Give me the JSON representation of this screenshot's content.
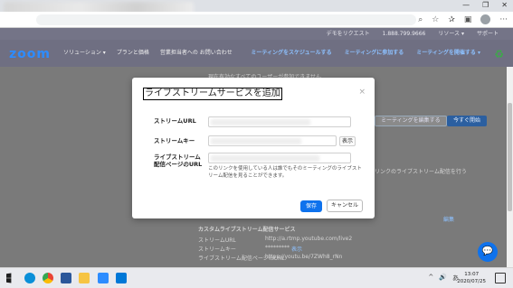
{
  "browser": {
    "window_controls": [
      "—",
      "❐",
      "✕"
    ],
    "toolbar_icons": [
      "search-icon",
      "star-icon",
      "collection-icon",
      "tab-icon",
      "profile-icon",
      "more-icon"
    ]
  },
  "zoom_top": {
    "links": [
      "デモをリクエスト",
      "1.888.799.9666",
      "リソース ▾",
      "サポート"
    ]
  },
  "nav": {
    "logo": "zoom",
    "left": [
      "ソリューション ▾",
      "プランと価格",
      "営業担当者への お問い合わせ"
    ],
    "right": [
      "ミーティングをスケジュールする",
      "ミーティングに参加する",
      "ミーティングを開催する ▾"
    ]
  },
  "background": {
    "top_text": "現在有効なすべてのユーザーが参加できません",
    "edit_button": "ミーティングを編集する",
    "start_button": "今すぐ開始",
    "right_text": "リンクのライブストリーム配信を行う",
    "edit_link": "編集",
    "custom_header": "カスタムライブストリーム配信サービス",
    "stream_url_label": "ストリームURL",
    "stream_url_value": "http://a.rtmp.youtube.com/live2",
    "stream_key_label": "ストリームキー",
    "stream_key_value": "*********",
    "show_link": "表示",
    "page_url_label": "ライブストリーム配信ページのURL",
    "page_url_value": "https://youtu.be/7ZWh8_rNn"
  },
  "dialog": {
    "title": "ライブストリームサービスを追加",
    "close": "×",
    "stream_url_label": "ストリームURL",
    "stream_key_label": "ストリームキー",
    "show_label": "表示",
    "page_url_label": "ライブストリーム配信ページのURL",
    "help_text": "このリンクを使用している人は誰でもそのミーティングのライブストリーム配信を見ることができます。",
    "save": "保存",
    "cancel": "キャンセル"
  },
  "taskbar": {
    "time": "13:07",
    "date": "2020/07/25",
    "tray": [
      "^",
      "🔊",
      "あ"
    ]
  }
}
